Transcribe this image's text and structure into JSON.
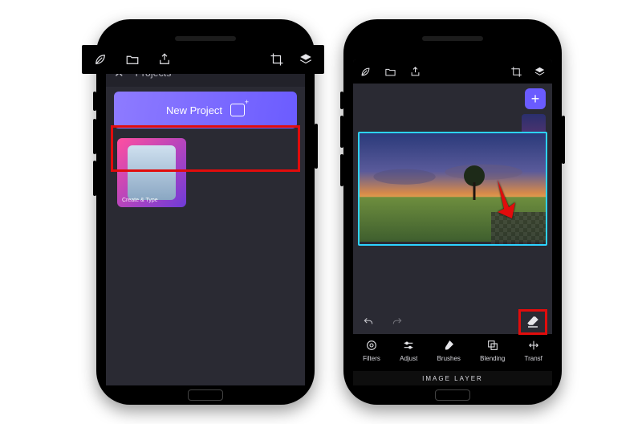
{
  "left": {
    "header_title": "Projects",
    "new_project_label": "New Project",
    "thumb_caption": "Create & Type"
  },
  "right": {
    "add_symbol": "+",
    "tools": [
      {
        "label": "Filters"
      },
      {
        "label": "Adjust"
      },
      {
        "label": "Brushes"
      },
      {
        "label": "Blending"
      },
      {
        "label": "Transf"
      }
    ],
    "footer_label": "IMAGE LAYER"
  },
  "toolbar_icons": {
    "leaf": "leaf-icon",
    "folder": "folder-icon",
    "share": "share-icon",
    "crop": "crop-icon",
    "layers": "layers-icon"
  },
  "colors": {
    "accent": "#6a5bff",
    "highlight": "#e10c0c",
    "canvas_border": "#2dd3ff"
  }
}
